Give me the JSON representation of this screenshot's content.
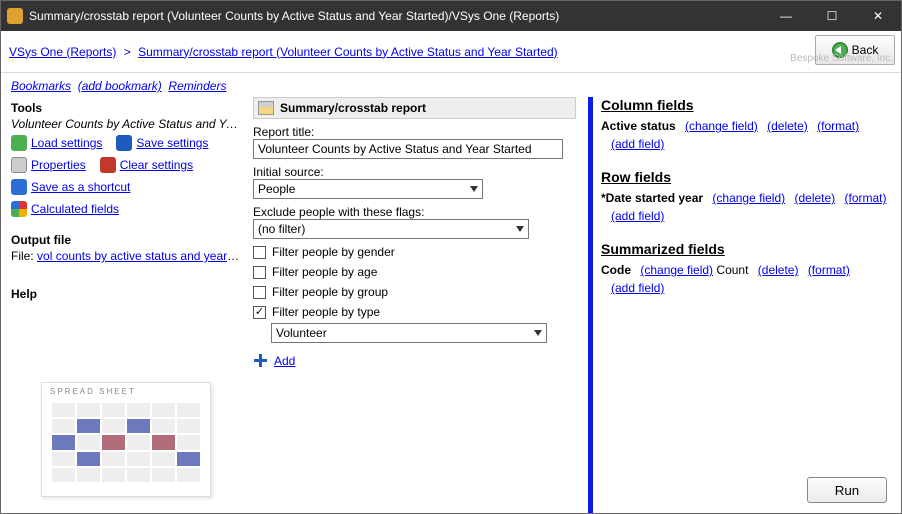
{
  "window": {
    "title": "Summary/crosstab report (Volunteer Counts by Active Status and Year Started)/VSys One (Reports)",
    "watermark": "Bespoke Software, Inc.",
    "buttons": {
      "min": "—",
      "max": "☐",
      "close": "✕"
    },
    "back_label": "Back"
  },
  "breadcrumb": {
    "root": "VSys One (Reports)",
    "sep": ">",
    "current": "Summary/crosstab report (Volunteer Counts by Active Status and Year Started)"
  },
  "linkbar": {
    "bookmarks": "Bookmarks",
    "add_bookmark": "(add bookmark)",
    "reminders": "Reminders"
  },
  "left": {
    "tools_heading": "Tools",
    "subtitle": "Volunteer Counts by Active Status and Year S...",
    "load_settings": "Load settings",
    "save_settings": "Save settings",
    "properties": "Properties",
    "clear_settings": "Clear settings",
    "save_shortcut": "Save as a shortcut",
    "calculated_fields": "Calculated fields",
    "output_heading": "Output file",
    "file_prefix": "File:",
    "file_link": "vol counts by active status and year start...",
    "help_heading": "Help",
    "preview_label": "SPREAD SHEET"
  },
  "mid": {
    "section_title": "Summary/crosstab report",
    "title_label": "Report title:",
    "title_value": "Volunteer Counts by Active Status and Year Started",
    "source_label": "Initial source:",
    "source_value": "People",
    "exclude_label": "Exclude people with these flags:",
    "exclude_value": "(no filter)",
    "filters": {
      "gender": "Filter people by gender",
      "age": "Filter people by age",
      "group": "Filter people by group",
      "type": "Filter people by type"
    },
    "type_value": "Volunteer",
    "add": "Add"
  },
  "right": {
    "column_heading": "Column fields",
    "column_field": "Active status",
    "row_heading": "Row fields",
    "row_field": "*Date started year",
    "sum_heading": "Summarized fields",
    "sum_field": "Code",
    "sum_stat": "Count",
    "change_field": "(change field)",
    "delete": "(delete)",
    "format": "(format)",
    "add_field": "(add field)"
  },
  "run_label": "Run"
}
